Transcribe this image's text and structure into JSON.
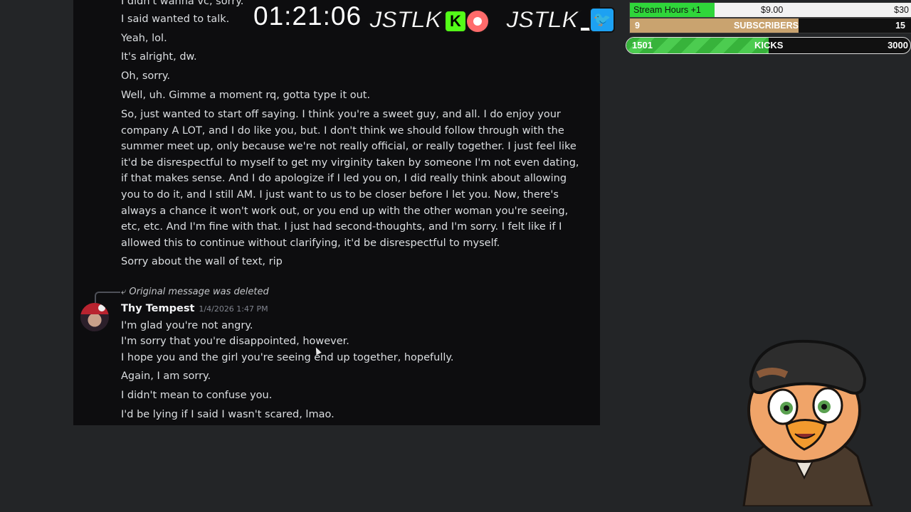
{
  "chat": {
    "lines_top": [
      "I didn't wanna vc, sorry.",
      "I said wanted to talk.",
      "Yeah, lol.",
      "It's alright, dw.",
      "Oh, sorry.",
      "Well, uh. Gimme a moment rq, gotta type it out."
    ],
    "long_message": "So, just wanted to start off saying. I think you're a sweet guy, and all. I do enjoy your company A LOT, and I do like you, but. I don't think we should follow through with the summer meet up, only because we're not really official, or really together. I just feel like it'd be disrespectful to myself to get my virginity taken by someone I'm not even dating, if that makes sense. And I do apologize if I led you on, I did really think about allowing you to do it, and I still AM. I just want to us to be closer before I let you. Now, there's always a chance it won't work out, or you end up with the other woman you're seeing, etc, etc. And I'm fine with that. I just had second-thoughts, and I'm sorry. I felt like if I allowed this to continue without clarifying, it'd be disrespectful to myself.",
    "after_long": "Sorry about the wall of text, rip",
    "reply_notice": "Original message was deleted",
    "author": "Thy Tempest",
    "timestamp": "1/4/2026 1:47 PM",
    "reply_lines": [
      "I'm glad you're not angry.",
      "I'm sorry that you're disappointed, however.",
      "I hope you and the girl you're seeing end up together, hopefully.",
      "Again, I am sorry.",
      "I didn't mean to confuse you.",
      "I'd be lying if I said I wasn't scared, lmao."
    ]
  },
  "overlay": {
    "timer": "01:21:06",
    "logo_text": "JSTLK",
    "kick_badge": "K",
    "twitter_icon": "twitter-bird"
  },
  "goals": {
    "stream_hours": {
      "label": "Stream Hours +1",
      "current": "$9.00",
      "target": "$30",
      "progress": 0.3
    },
    "subscribers": {
      "current": "9",
      "label": "SUBSCRIBERS",
      "target": "15",
      "progress": 0.6
    },
    "kicks": {
      "current": "1501",
      "label": "KICKS",
      "target": "3000",
      "progress": 0.5
    }
  },
  "colors": {
    "chat_bg": "#0d0d0f",
    "page_bg": "#232527",
    "kick_green": "#53fc18",
    "twitter_blue": "#1da1f2",
    "sub_fill": "#c9a36f"
  }
}
